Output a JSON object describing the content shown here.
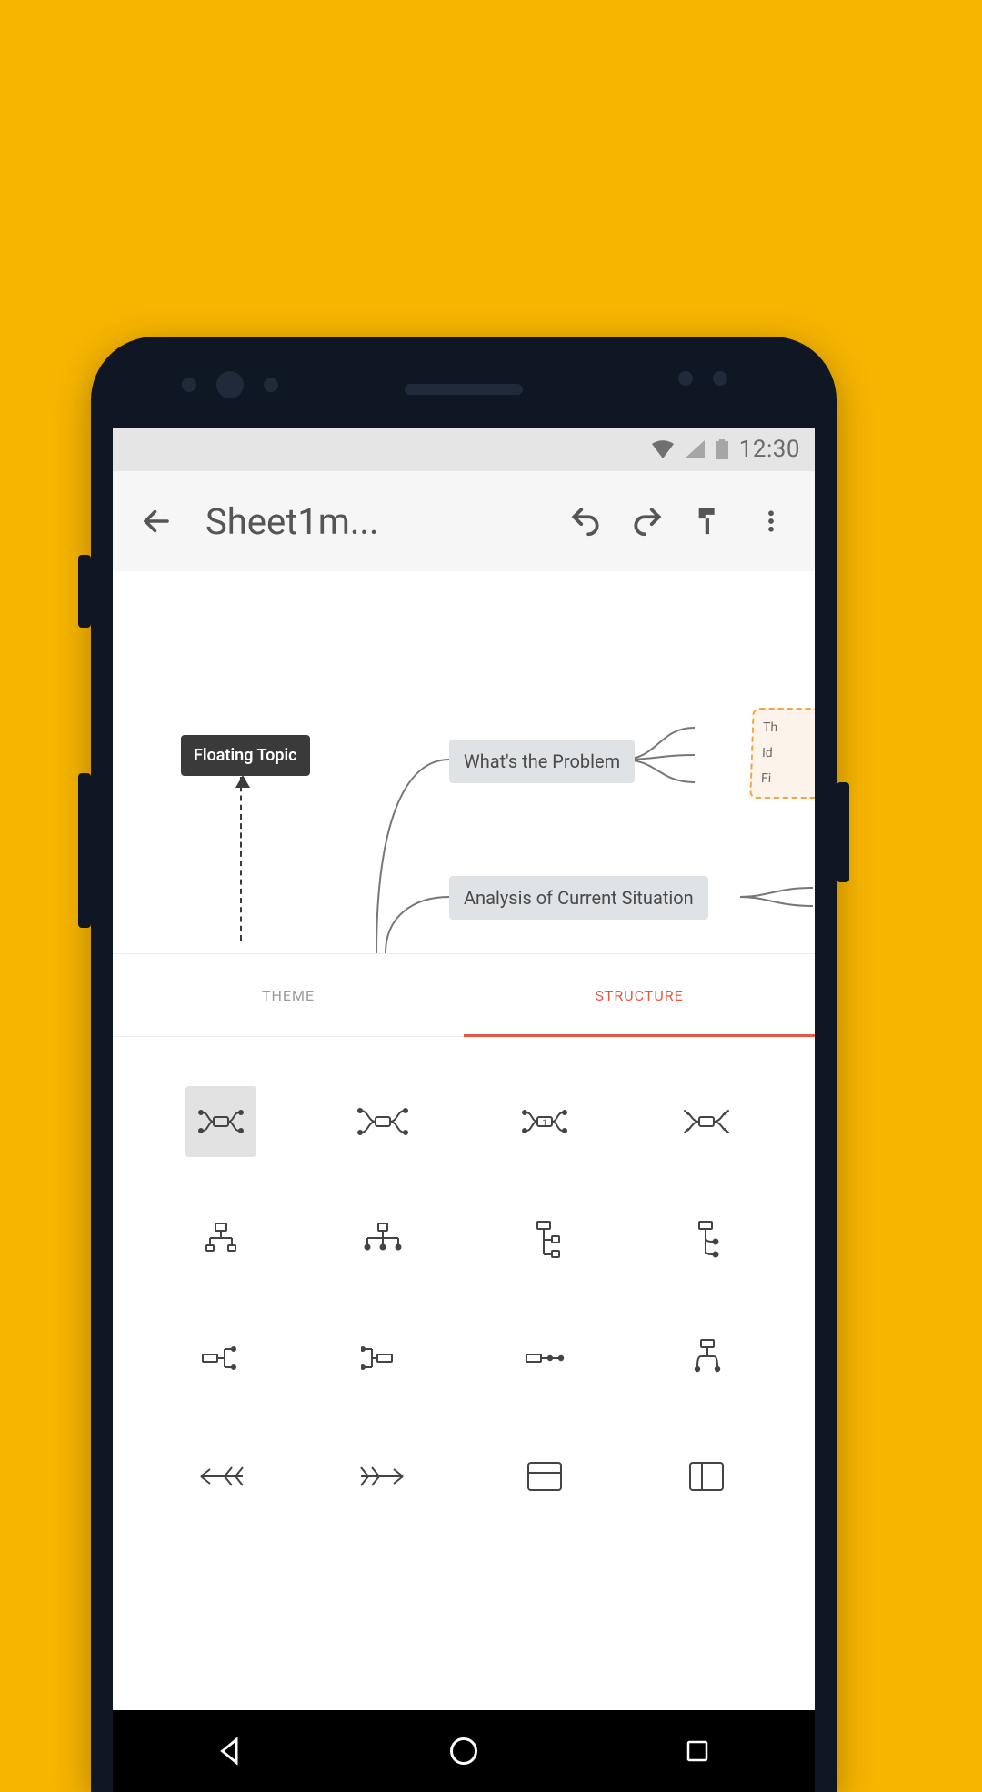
{
  "status": {
    "time": "12:30"
  },
  "toolbar": {
    "title": "Sheet1m..."
  },
  "canvas": {
    "floating_label": "Floating Topic",
    "node1_label": "What's the Problem",
    "node2_label": "Analysis of Current Situation",
    "sub_labels": {
      "a": "Th",
      "b": "Id",
      "c": "Fi"
    }
  },
  "tabs": {
    "theme": "THEME",
    "structure": "STRUCTURE"
  },
  "structures": [
    "map-balanced",
    "map-right",
    "map-left",
    "map-clockwise",
    "org-down",
    "org-down-wide",
    "org-right",
    "org-right-2",
    "logic-right",
    "logic-right-2",
    "logic-line",
    "tree-right",
    "fishbone-left",
    "fishbone-right",
    "matrix",
    "column"
  ]
}
